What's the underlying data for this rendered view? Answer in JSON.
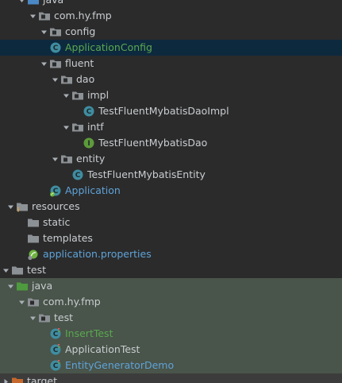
{
  "colors": {
    "background": "#2b2b2b",
    "selected_row": "#0d293e",
    "test_source_row": "#49544a",
    "excluded_row": "#3c3c3c",
    "text_default": "#c9cdd1",
    "text_modified_blue": "#5fa3d9",
    "text_new_green": "#5aa94f",
    "folder": "#8c9196",
    "class_icon": "#3f8da1",
    "interface_icon": "#5d9a3a"
  },
  "tree": {
    "rows": [
      {
        "label": "java",
        "icon": "source-folder-icon",
        "arrow": "expanded",
        "color": "default"
      },
      {
        "label": "com.hy.fmp",
        "icon": "package-icon",
        "arrow": "expanded",
        "color": "default"
      },
      {
        "label": "config",
        "icon": "package-icon",
        "arrow": "expanded",
        "color": "default"
      },
      {
        "label": "ApplicationConfig",
        "icon": "class-icon",
        "arrow": "none",
        "color": "green",
        "selected": true
      },
      {
        "label": "fluent",
        "icon": "package-icon",
        "arrow": "expanded",
        "color": "default"
      },
      {
        "label": "dao",
        "icon": "package-icon",
        "arrow": "expanded",
        "color": "default"
      },
      {
        "label": "impl",
        "icon": "package-icon",
        "arrow": "expanded",
        "color": "default"
      },
      {
        "label": "TestFluentMybatisDaoImpl",
        "icon": "class-icon",
        "arrow": "none",
        "color": "default"
      },
      {
        "label": "intf",
        "icon": "package-icon",
        "arrow": "expanded",
        "color": "default"
      },
      {
        "label": "TestFluentMybatisDao",
        "icon": "interface-icon",
        "arrow": "none",
        "color": "default"
      },
      {
        "label": "entity",
        "icon": "package-icon",
        "arrow": "expanded",
        "color": "default"
      },
      {
        "label": "TestFluentMybatisEntity",
        "icon": "class-icon",
        "arrow": "none",
        "color": "default"
      },
      {
        "label": "Application",
        "icon": "spring-class-icon",
        "arrow": "none",
        "color": "blue"
      },
      {
        "label": "resources",
        "icon": "resources-folder-icon",
        "arrow": "expanded",
        "color": "default"
      },
      {
        "label": "static",
        "icon": "folder-icon",
        "arrow": "none",
        "color": "default"
      },
      {
        "label": "templates",
        "icon": "folder-icon",
        "arrow": "none",
        "color": "default"
      },
      {
        "label": "application.properties",
        "icon": "spring-properties-icon",
        "arrow": "none",
        "color": "blue"
      },
      {
        "label": "test",
        "icon": "folder-icon",
        "arrow": "expanded",
        "color": "default"
      },
      {
        "label": "java",
        "icon": "test-source-folder-icon",
        "arrow": "expanded",
        "color": "default",
        "bg": "test"
      },
      {
        "label": "com.hy.fmp",
        "icon": "package-icon",
        "arrow": "expanded",
        "color": "default",
        "bg": "test"
      },
      {
        "label": "test",
        "icon": "package-icon",
        "arrow": "expanded",
        "color": "default",
        "bg": "test"
      },
      {
        "label": "InsertTest",
        "icon": "test-class-icon",
        "arrow": "none",
        "color": "green",
        "bg": "test"
      },
      {
        "label": "ApplicationTest",
        "icon": "test-class-icon",
        "arrow": "none",
        "color": "default",
        "bg": "test"
      },
      {
        "label": "EntityGeneratorDemo",
        "icon": "test-class-icon",
        "arrow": "none",
        "color": "blue",
        "bg": "test"
      },
      {
        "label": "target",
        "icon": "excluded-folder-icon",
        "arrow": "collapsed",
        "color": "default",
        "bg": "target"
      }
    ]
  }
}
